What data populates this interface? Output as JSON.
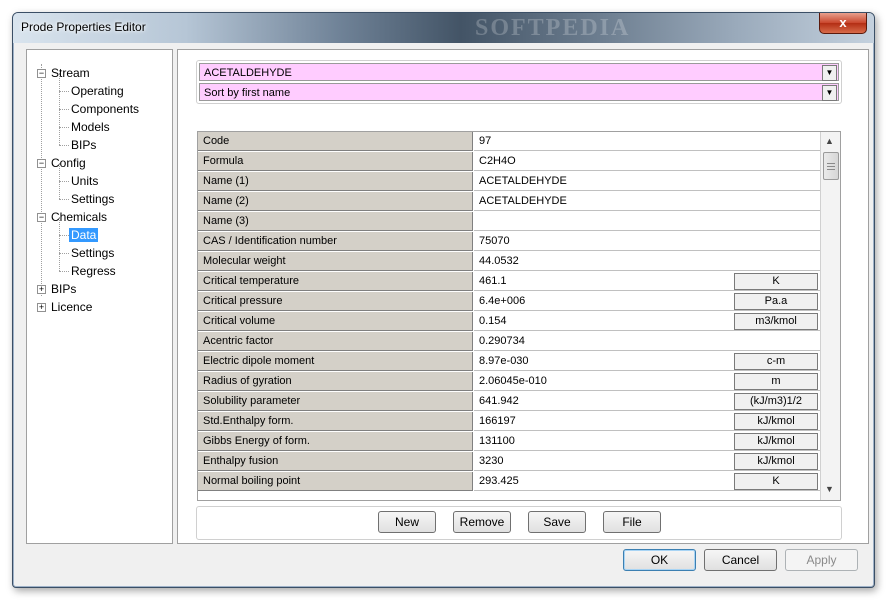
{
  "window": {
    "title": "Prode Properties Editor",
    "watermark": "SOFTPEDIA",
    "close_glyph": "x"
  },
  "tree": {
    "stream": "Stream",
    "operating": "Operating",
    "components": "Components",
    "models": "Models",
    "bips_child": "BIPs",
    "config": "Config",
    "units": "Units",
    "config_settings": "Settings",
    "chemicals": "Chemicals",
    "data": "Data",
    "chem_settings": "Settings",
    "regress": "Regress",
    "bips": "BIPs",
    "licence": "Licence",
    "minus": "−",
    "plus": "+"
  },
  "combo": {
    "component": "ACETALDEHYDE",
    "sort": "Sort by first name",
    "arrow": "▼"
  },
  "grid": {
    "rows": [
      {
        "label": "Code",
        "value": "97",
        "unit": ""
      },
      {
        "label": "Formula",
        "value": "C2H4O",
        "unit": ""
      },
      {
        "label": "Name (1)",
        "value": "ACETALDEHYDE",
        "unit": ""
      },
      {
        "label": "Name (2)",
        "value": "ACETALDEHYDE",
        "unit": ""
      },
      {
        "label": "Name (3)",
        "value": "",
        "unit": ""
      },
      {
        "label": "CAS / Identification number",
        "value": "75070",
        "unit": ""
      },
      {
        "label": "Molecular weight",
        "value": "44.0532",
        "unit": ""
      },
      {
        "label": "Critical temperature",
        "value": "461.1",
        "unit": "K"
      },
      {
        "label": "Critical pressure",
        "value": "6.4e+006",
        "unit": "Pa.a"
      },
      {
        "label": "Critical volume",
        "value": "0.154",
        "unit": "m3/kmol"
      },
      {
        "label": "Acentric factor",
        "value": "0.290734",
        "unit": ""
      },
      {
        "label": "Electric dipole moment",
        "value": "8.97e-030",
        "unit": "c-m"
      },
      {
        "label": "Radius of gyration",
        "value": "2.06045e-010",
        "unit": "m"
      },
      {
        "label": "Solubility parameter",
        "value": "641.942",
        "unit": "(kJ/m3)1/2"
      },
      {
        "label": "Std.Enthalpy form.",
        "value": "166197",
        "unit": "kJ/kmol"
      },
      {
        "label": "Gibbs Energy of form.",
        "value": "131100",
        "unit": "kJ/kmol"
      },
      {
        "label": "Enthalpy fusion",
        "value": "3230",
        "unit": "kJ/kmol"
      },
      {
        "label": "Normal boiling point",
        "value": "293.425",
        "unit": "K"
      }
    ],
    "scroll_up": "▲",
    "scroll_down": "▼"
  },
  "actions": {
    "new": "New",
    "remove": "Remove",
    "save": "Save",
    "file": "File"
  },
  "footer": {
    "ok": "OK",
    "cancel": "Cancel",
    "apply": "Apply"
  }
}
